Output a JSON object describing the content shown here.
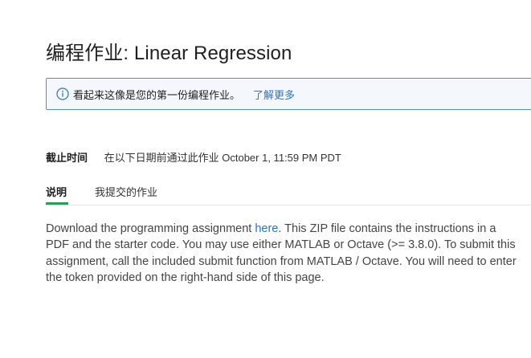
{
  "page": {
    "title": "编程作业: Linear Regression"
  },
  "banner": {
    "icon": "info-icon",
    "text": "看起来这像是您的第一份编程作业。",
    "link_label": "了解更多",
    "border_color": "#4e8ec9",
    "link_color": "#2a73cc"
  },
  "deadline": {
    "label": "截止时间",
    "value": "在以下日期前通过此作业 October 1, 11:59 PM PDT"
  },
  "tabs": [
    {
      "label": "说明",
      "active": true
    },
    {
      "label": "我提交的作业",
      "active": false
    }
  ],
  "tab_accent_color": "#2a9d5c",
  "description": {
    "before_link": "Download the programming assignment ",
    "link_label": "here",
    "after_link": ". This ZIP file contains the instructions in a PDF and the starter code. You may use either MATLAB or Octave (>= 3.8.0). To submit this assignment, call the included submit function from MATLAB / Octave. You will need to enter the token provided on the right-hand side of this page."
  }
}
